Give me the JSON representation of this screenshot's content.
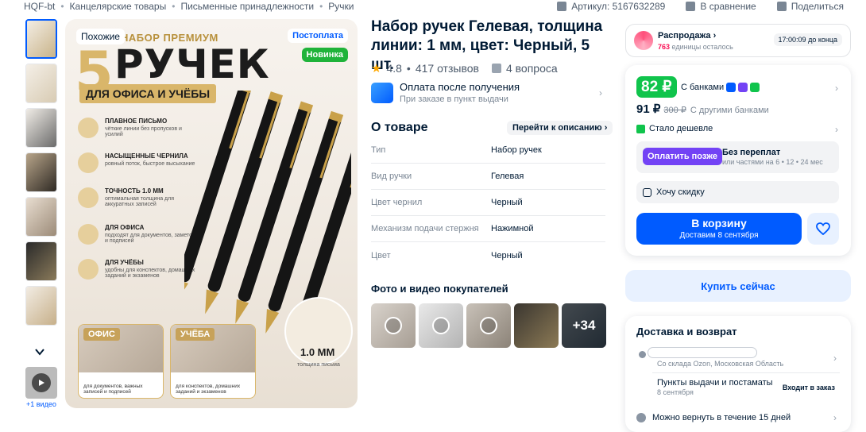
{
  "breadcrumbs": [
    "HQF-bt",
    "Канцелярские товары",
    "Письменные принадлежности",
    "Ручки"
  ],
  "top_actions": {
    "article": "Артикул: 5167632289",
    "compare": "В сравнение",
    "share": "Поделиться"
  },
  "thumbs_video_label": "+1 видео",
  "main_image": {
    "similar": "Похожие",
    "badge_post": "Постоплата",
    "badge_new": "Новинка",
    "headline_kit": "НАБОР ПРЕМИУМ",
    "headline_num": "5",
    "headline_word": "РУЧЕК",
    "band": "ДЛЯ ОФИСА И УЧЁБЫ",
    "features": [
      {
        "title": "ПЛАВНОЕ ПИСЬМО",
        "text": "чёткие линии без пропусков и усилий"
      },
      {
        "title": "НАСЫЩЕННЫЕ ЧЕРНИЛА",
        "text": "ровный поток, быстрое высыхание"
      },
      {
        "title": "ТОЧНОСТЬ 1.0 ММ",
        "text": "оптимальная толщина для аккуратных записей"
      },
      {
        "title": "ДЛЯ ОФИСА",
        "text": "подходят для документов, заметок и подписей"
      },
      {
        "title": "ДЛЯ УЧЁБЫ",
        "text": "удобны для конспектов, домашних заданий и экзаменов"
      }
    ],
    "cards": [
      {
        "label": "ОФИС",
        "text": "для документов, важных записей и подписей"
      },
      {
        "label": "УЧЁБА",
        "text": "для конспектов, домашних заданий и экзаменов"
      }
    ],
    "mm": "1.0 ММ",
    "mm_sub": "толщина письма"
  },
  "product": {
    "title": "Набор ручек Гелевая, толщина линии: 1 мм, цвет: Черный, 5 шт.",
    "rating": "4.8",
    "reviews": "417 отзывов",
    "questions": "4 вопроса",
    "pay_title": "Оплата после получения",
    "pay_sub": "При заказе в пункт выдачи",
    "about": "О товаре",
    "goto_desc": "Перейти к описанию",
    "specs": [
      {
        "k": "Тип",
        "v": "Набор ручек"
      },
      {
        "k": "Вид ручки",
        "v": "Гелевая"
      },
      {
        "k": "Цвет чернил",
        "v": "Черный"
      },
      {
        "k": "Механизм подачи стержня",
        "v": "Нажимной"
      },
      {
        "k": "Цвет",
        "v": "Черный"
      }
    ],
    "photos_title": "Фото и видео покупателей",
    "photos_more": "+34"
  },
  "sale": {
    "title": "Распродажа",
    "count": "763",
    "count_suffix": "единицы осталось",
    "timer": "17:00:09 до конца"
  },
  "price": {
    "bank_price": "82 ₽",
    "bank_text": "С банками",
    "price": "91 ₽",
    "old_price": "300 ₽",
    "other_banks": "С другими банками",
    "cheaper": "Стало дешевле",
    "pay_later_btn": "Оплатить позже",
    "no_overpay": "Без переплат",
    "installments": "или частями на 6 • 12 • 24 мес",
    "want_discount": "Хочу скидку",
    "cart": "В корзину",
    "cart_sub": "Доставим 8 сентября",
    "buy_now": "Купить сейчас"
  },
  "delivery": {
    "title": "Доставка и возврат",
    "from": "Со склада Ozon, Московская Область",
    "pickup": "Пункты выдачи и постаматы",
    "pickup_date": "8 сентября",
    "included": "Входит в заказ",
    "return": "Можно вернуть в течение 15 дней"
  },
  "colors": {
    "accent": "#005bff",
    "green": "#10c44c",
    "purple": "#7343f5",
    "gold": "#d9b66a"
  }
}
